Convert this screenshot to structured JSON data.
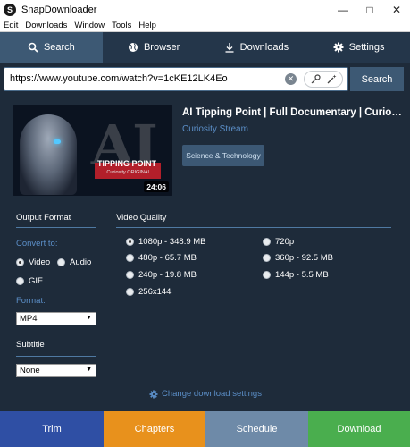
{
  "window": {
    "title": "SnapDownloader",
    "app_icon_letter": "S"
  },
  "menu": {
    "items": [
      "Edit",
      "Downloads",
      "Window",
      "Tools",
      "Help"
    ]
  },
  "tabs": [
    {
      "label": "Search",
      "icon": "search-icon",
      "active": true
    },
    {
      "label": "Browser",
      "icon": "globe-icon",
      "active": false
    },
    {
      "label": "Downloads",
      "icon": "download-icon",
      "active": false
    },
    {
      "label": "Settings",
      "icon": "gear-icon",
      "active": false
    }
  ],
  "search": {
    "url_value": "https://www.youtube.com/watch?v=1cKE12LK4Eo",
    "button_label": "Search"
  },
  "video": {
    "title": "AI Tipping Point | Full Documentary | Curiosity Stream",
    "channel": "Curiosity Stream",
    "category": "Science & Technology",
    "duration": "24:06",
    "thumbnail_title": "TIPPING POINT",
    "thumbnail_brand": "Curiosity ORIGINAL",
    "thumbnail_big_text": "AI"
  },
  "output_format": {
    "heading": "Output Format",
    "convert_to_label": "Convert to:",
    "options": [
      {
        "label": "Video",
        "selected": true
      },
      {
        "label": "Audio",
        "selected": false
      },
      {
        "label": "GIF",
        "selected": false
      }
    ],
    "format_label": "Format:",
    "format_value": "MP4"
  },
  "subtitle": {
    "heading": "Subtitle",
    "value": "None"
  },
  "video_quality": {
    "heading": "Video Quality",
    "options": [
      {
        "label": "1080p - 348.9 MB",
        "selected": true
      },
      {
        "label": "720p",
        "selected": false
      },
      {
        "label": "480p - 65.7 MB",
        "selected": false
      },
      {
        "label": "360p - 92.5 MB",
        "selected": false
      },
      {
        "label": "240p - 19.8 MB",
        "selected": false
      },
      {
        "label": "144p - 5.5 MB",
        "selected": false
      },
      {
        "label": "256x144",
        "selected": false
      }
    ]
  },
  "settings_link": {
    "label": "Change download settings"
  },
  "bottom": {
    "trim": "Trim",
    "chapters": "Chapters",
    "schedule": "Schedule",
    "download": "Download"
  },
  "colors": {
    "background": "#1e2b3a",
    "tab_active": "#3d5974",
    "accent_blue": "#5b8ec7",
    "trim": "#2f4fa4",
    "chapters": "#e8911c",
    "schedule": "#6e8aa8",
    "download": "#4aae4e"
  }
}
